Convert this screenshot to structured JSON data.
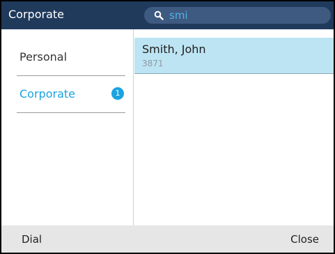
{
  "header": {
    "title": "Corporate",
    "search": {
      "icon": "search-icon",
      "query": "smi"
    }
  },
  "left_panel": {
    "items": [
      {
        "label": "Personal",
        "badge": ""
      },
      {
        "label": "Corporate",
        "badge": "1",
        "active": true
      }
    ]
  },
  "results": [
    {
      "name": "Smith, John",
      "number": "3871"
    }
  ],
  "softkeys": {
    "left": "Dial",
    "right": "Close"
  },
  "colors": {
    "header_bg": "#203a5c",
    "accent": "#1aa3e0",
    "selected_row_bg": "#bde4f3",
    "softkey_bg": "#e6e6e6"
  }
}
